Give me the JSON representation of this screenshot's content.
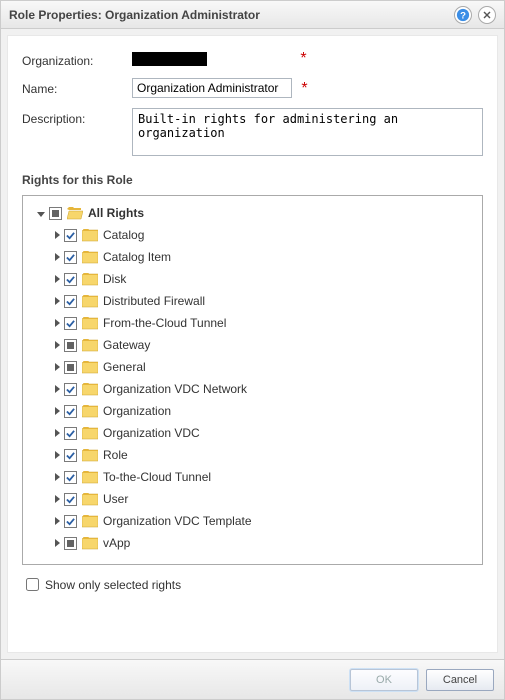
{
  "title": "Role Properties: Organization Administrator",
  "form": {
    "organization": {
      "label": "Organization:",
      "value": "████████",
      "required": true
    },
    "name": {
      "label": "Name:",
      "value": "Organization Administrator",
      "required": true
    },
    "description": {
      "label": "Description:",
      "value": "Built-in rights for administering an organization"
    }
  },
  "rights_header": "Rights for this Role",
  "tree": {
    "root": {
      "label": "All Rights",
      "state": "mixed",
      "expanded": true
    },
    "children": [
      {
        "label": "Catalog",
        "state": "checked"
      },
      {
        "label": "Catalog Item",
        "state": "checked"
      },
      {
        "label": "Disk",
        "state": "checked"
      },
      {
        "label": "Distributed Firewall",
        "state": "checked"
      },
      {
        "label": "From-the-Cloud Tunnel",
        "state": "checked"
      },
      {
        "label": "Gateway",
        "state": "mixed"
      },
      {
        "label": "General",
        "state": "mixed"
      },
      {
        "label": "Organization VDC Network",
        "state": "checked"
      },
      {
        "label": "Organization",
        "state": "checked"
      },
      {
        "label": "Organization VDC",
        "state": "checked"
      },
      {
        "label": "Role",
        "state": "checked"
      },
      {
        "label": "To-the-Cloud Tunnel",
        "state": "checked"
      },
      {
        "label": "User",
        "state": "checked"
      },
      {
        "label": "Organization VDC Template",
        "state": "checked"
      },
      {
        "label": "vApp",
        "state": "mixed"
      }
    ]
  },
  "show_only_selected": {
    "label": "Show only selected rights",
    "checked": false
  },
  "buttons": {
    "ok": "OK",
    "cancel": "Cancel",
    "ok_enabled": false
  },
  "icons": {
    "help": "help-icon",
    "close": "close-icon"
  }
}
